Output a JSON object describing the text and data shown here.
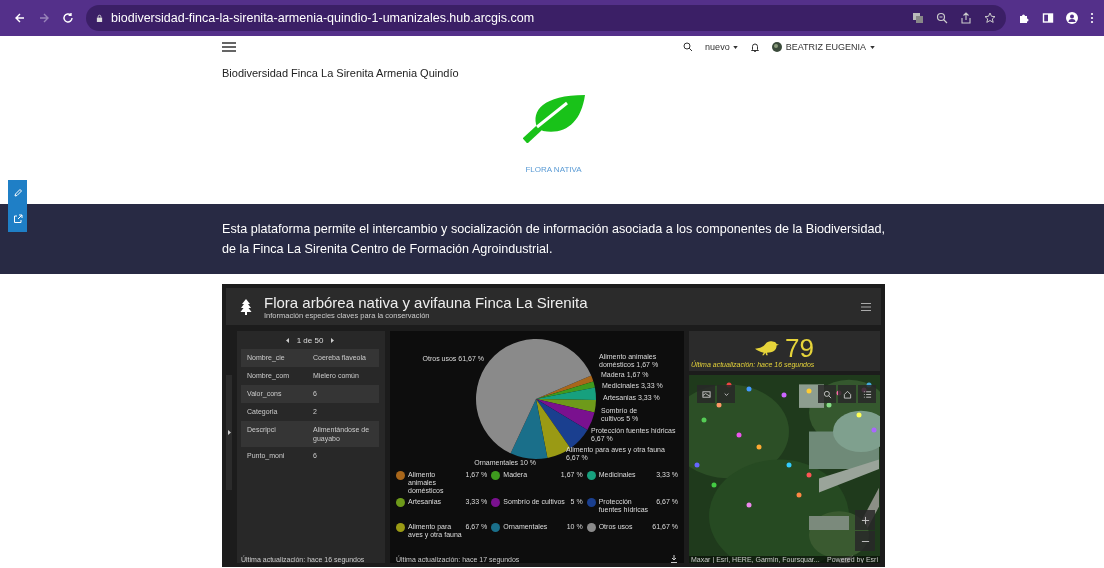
{
  "browser": {
    "url": "biodiversidad-finca-la-sirenita-armenia-quindio-1-umanizales.hub.arcgis.com",
    "forward_disabled": true
  },
  "topnav": {
    "new_menu": "nuevo",
    "user": "BEATRIZ EUGENIA"
  },
  "site_title": "Biodiversidad Finca La Sirenita Armenia Quindío",
  "feature": {
    "label": "FLORA NATIVA"
  },
  "banner": {
    "text": "Esta plataforma permite el intercambio y socialización de información asociada a los componentes de la Biodiversidad, de la Finca La Sirenita Centro de Formación Agroindustrial."
  },
  "dashboard": {
    "title": "Flora arbórea nativa y avifauna Finca La Sirenita",
    "subtitle": "Información especies claves para la conservación",
    "details": {
      "pager": "1 de 50",
      "rows": [
        {
          "field": "Nombre_cie",
          "value": "Coereba flaveola"
        },
        {
          "field": "Nombre_com",
          "value": "Mielero común"
        },
        {
          "field": "Valor_cons",
          "value": "6"
        },
        {
          "field": "Categoria",
          "value": "2"
        },
        {
          "field": "Descripci",
          "value": "Alimentándose de guayabo"
        },
        {
          "field": "Punto_moni",
          "value": "6"
        }
      ],
      "updated": "Última actualización: hace 16 segundos"
    },
    "chart": {
      "chart_data": {
        "type": "pie",
        "categories": [
          "Alimento animales domésticos",
          "Madera",
          "Medicinales",
          "Artesanias",
          "Sombrío de cultivos",
          "Protección fuentes hídricas",
          "Alimento para aves y otra fauna",
          "Ornamentales",
          "Otros usos"
        ],
        "values": [
          1.67,
          1.67,
          3.33,
          3.33,
          5,
          6.67,
          6.67,
          10,
          61.67
        ],
        "data_labels": true,
        "value_labels": [
          "Alimento animales domésticos 1,67 %",
          "Madera 1,67 %",
          "Medicinales 3,33 %",
          "Artesanias 3,33 %",
          "Sombrío de cultivos 5 %",
          "Protección fuentes hídricas 6,67 %",
          "Alimento para aves y otra fauna 6,67 %",
          "Ornamentales 10 %",
          "Otros usos 61,67 %"
        ]
      },
      "legend": [
        {
          "value": "1,67 %",
          "color": "#a8661a"
        },
        {
          "value": "1,67 %",
          "color": "#3e9a1e"
        },
        {
          "value": "3,33 %",
          "color": "#17a07e"
        },
        {
          "value": "3,33 %",
          "color": "#6e9a1a"
        },
        {
          "value": "5 %",
          "color": "#7a118f"
        },
        {
          "value": "6,67 %",
          "color": "#1a3f8f"
        },
        {
          "value": "6,67 %",
          "color": "#9a9a14"
        },
        {
          "value": "10 %",
          "color": "#1a6f8a"
        },
        {
          "value": "61,67 %",
          "color": "#8a8a8a"
        }
      ],
      "updated": "Última actualización: hace 17 segundos"
    },
    "indicator": {
      "value": "79",
      "updated": "Última actualización: hace 16 segundos"
    },
    "map": {
      "attribution": "Maxar | Esri, HERE, Garmin, Foursquar...",
      "powered": "Powered by Esri"
    }
  }
}
